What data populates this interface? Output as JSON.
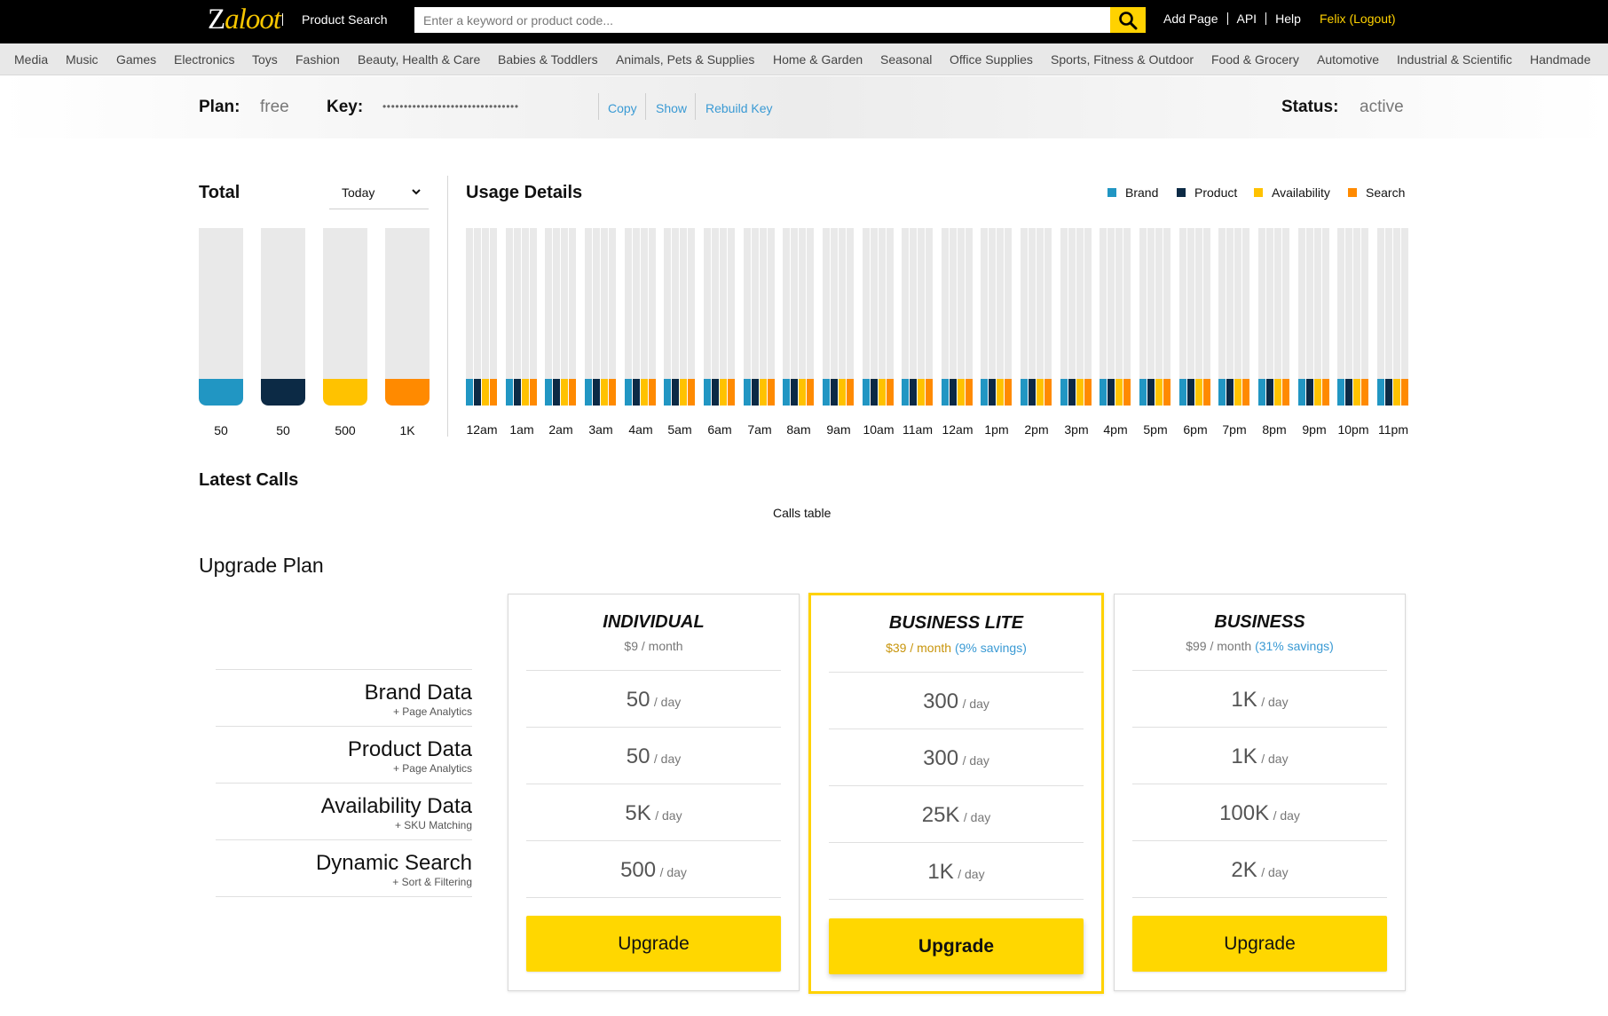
{
  "header": {
    "logo_text_z": "Z",
    "logo_text_rest": "aloot",
    "product_search_label": "Product Search",
    "search_placeholder": "Enter a keyword or product code...",
    "links": [
      "Add Page",
      "API",
      "Help"
    ],
    "user_name": "Felix",
    "logout_label": "(Logout)",
    "search_icon": "search-icon"
  },
  "categories": [
    "Media",
    "Music",
    "Games",
    "Electronics",
    "Toys",
    "Fashion",
    "Beauty, Health & Care",
    "Babies & Toddlers",
    "Animals, Pets & Supplies",
    "Home & Garden",
    "Seasonal",
    "Office Supplies",
    "Sports, Fitness & Outdoor",
    "Food & Grocery",
    "Automotive",
    "Industrial & Scientific",
    "Handmade"
  ],
  "plan_bar": {
    "plan_label": "Plan:",
    "plan_value": "free",
    "key_label": "Key:",
    "key_masked": "••••••••••••••••••••••••••••••••",
    "copy_label": "Copy",
    "show_label": "Show",
    "rebuild_label": "Rebuild Key",
    "status_label": "Status:",
    "status_value": "active"
  },
  "total": {
    "title": "Total",
    "period_selected": "Today",
    "bars": [
      {
        "label": "50",
        "color": "#2196c3",
        "fill_fraction": 0.15
      },
      {
        "label": "50",
        "color": "#0c2a45",
        "fill_fraction": 0.15
      },
      {
        "label": "500",
        "color": "#ffc200",
        "fill_fraction": 0.15
      },
      {
        "label": "1K",
        "color": "#ff8a00",
        "fill_fraction": 0.15
      }
    ]
  },
  "usage": {
    "title": "Usage Details",
    "legend": [
      {
        "name": "Brand",
        "color": "#2196c3"
      },
      {
        "name": "Product",
        "color": "#0c2a45"
      },
      {
        "name": "Availability",
        "color": "#ffc200"
      },
      {
        "name": "Search",
        "color": "#ff8a00"
      }
    ],
    "hours": [
      "12am",
      "1am",
      "2am",
      "3am",
      "4am",
      "5am",
      "6am",
      "7am",
      "8am",
      "9am",
      "10am",
      "11am",
      "12am",
      "1pm",
      "2pm",
      "3pm",
      "4pm",
      "5pm",
      "6pm",
      "7pm",
      "8pm",
      "9pm",
      "10pm",
      "11pm"
    ],
    "fill_fraction": 0.15
  },
  "latest_calls": {
    "title": "Latest Calls",
    "table_placeholder": "Calls table"
  },
  "upgrade": {
    "title": "Upgrade Plan",
    "features": [
      {
        "name": "Brand Data",
        "sub": "+ Page Analytics"
      },
      {
        "name": "Product Data",
        "sub": "+ Page Analytics"
      },
      {
        "name": "Availability Data",
        "sub": "+ SKU Matching"
      },
      {
        "name": "Dynamic Search",
        "sub": "+ Sort & Filtering"
      }
    ],
    "unit": "/ day",
    "plans": [
      {
        "name": "INDIVIDUAL",
        "price": "$9",
        "per": " / month",
        "savings": "",
        "values": [
          "50",
          "50",
          "5K",
          "500"
        ],
        "button": "Upgrade",
        "highlight": false
      },
      {
        "name": "BUSINESS LITE",
        "price": "$39",
        "per": " / month",
        "savings": "(9% savings)",
        "values": [
          "300",
          "300",
          "25K",
          "1K"
        ],
        "button": "Upgrade",
        "highlight": true
      },
      {
        "name": "BUSINESS",
        "price": "$99",
        "per": " / month",
        "savings": "(31% savings)",
        "values": [
          "1K",
          "1K",
          "100K",
          "2K"
        ],
        "button": "Upgrade",
        "highlight": false
      }
    ]
  }
}
